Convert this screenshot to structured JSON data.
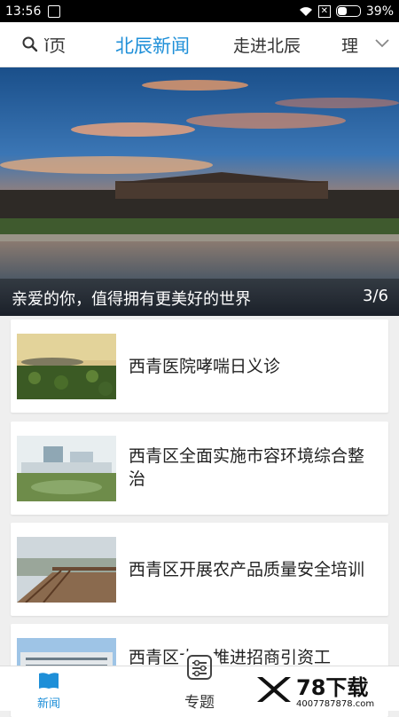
{
  "status_bar": {
    "time": "13:56",
    "battery": "39%",
    "battery_level": 0.39,
    "icons": [
      "notification-icon",
      "wifi-icon",
      "sim-off-icon",
      "battery-icon"
    ]
  },
  "tabs": [
    {
      "label": "首页",
      "partial": "ǐ页",
      "active": false
    },
    {
      "label": "北辰新闻",
      "active": true
    },
    {
      "label": "走进北辰",
      "active": false
    },
    {
      "label": "理",
      "active": false
    }
  ],
  "banner": {
    "caption": "亲爱的你，值得拥有更美好的世界",
    "counter": "3/6"
  },
  "news": [
    {
      "title": "西青医院哮喘日义诊"
    },
    {
      "title_line1": "西青区全面实施市容环境综合整",
      "title_line2": "治"
    },
    {
      "title": "西青区开展农产品质量安全培训"
    },
    {
      "title": "西青区大力推进招商引资工"
    }
  ],
  "bottom_nav": {
    "news_label": "新闻",
    "topic_label": "专题"
  },
  "watermark": {
    "brand": "78下载",
    "url": "4007787878.com"
  },
  "colors": {
    "accent": "#1e8fd8",
    "status_bar": "#000000",
    "background": "#efefef"
  }
}
